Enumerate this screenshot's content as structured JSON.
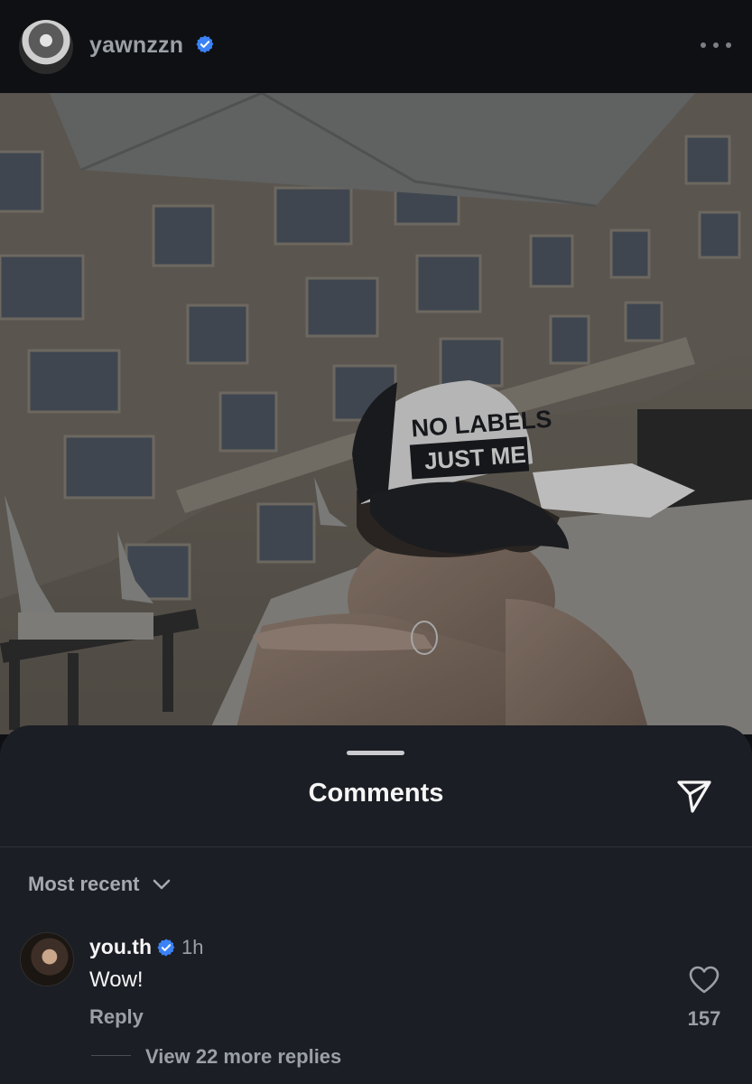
{
  "post": {
    "username": "yawnzzn",
    "verified": true,
    "icons": {
      "avatar": "profile-avatar",
      "verified": "verified-badge-icon",
      "more": "more-options-icon"
    },
    "photo": {
      "cap_line1": "NO LABELS",
      "cap_line2": "JUST ME"
    }
  },
  "comments_sheet": {
    "title": "Comments",
    "sort_label": "Most recent",
    "icons": {
      "share": "send-icon",
      "sort": "chevron-down-icon",
      "like": "heart-icon"
    },
    "comments": [
      {
        "username": "you.th",
        "verified": true,
        "time": "1h",
        "text": "Wow!",
        "reply_label": "Reply",
        "likes": "157",
        "more_replies": "View 22 more replies"
      }
    ]
  },
  "colors": {
    "background": "#0e1014",
    "sheet": "#1b1e24",
    "verified_blue": "#3b82f6",
    "muted_text": "#9aa0a6"
  }
}
